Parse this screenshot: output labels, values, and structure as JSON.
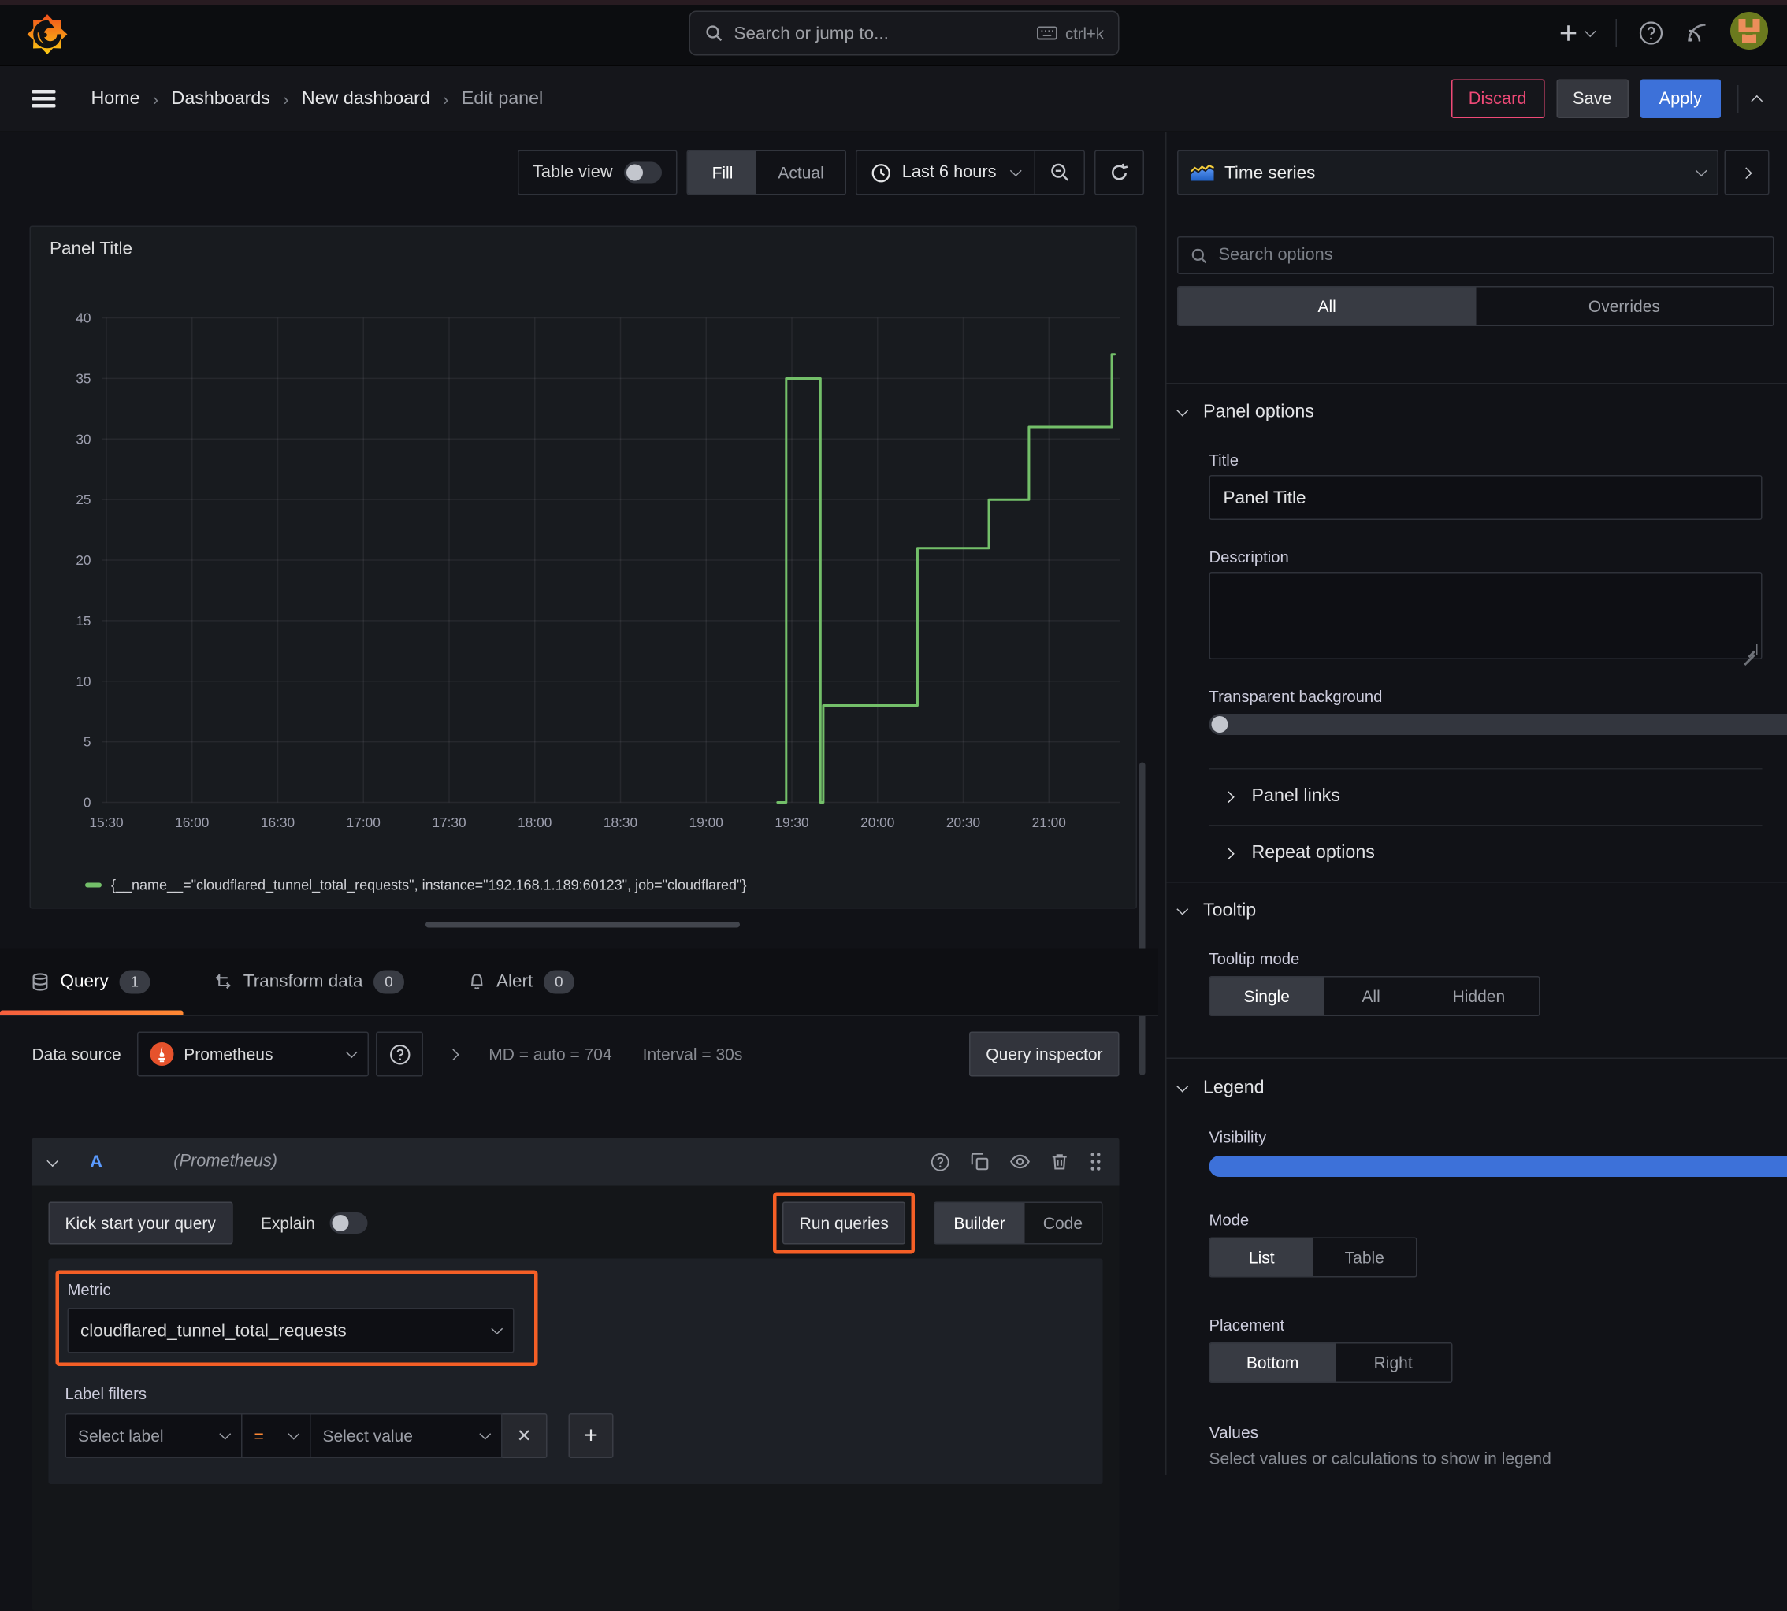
{
  "topbar": {
    "search_placeholder": "Search or jump to...",
    "shortcut": "ctrl+k"
  },
  "breadcrumb": {
    "items": [
      "Home",
      "Dashboards",
      "New dashboard",
      "Edit panel"
    ]
  },
  "header_actions": {
    "discard": "Discard",
    "save": "Save",
    "apply": "Apply"
  },
  "toolbar": {
    "table_view_label": "Table view",
    "fill_label": "Fill",
    "actual_label": "Actual",
    "time_range_label": "Last 6 hours"
  },
  "panel": {
    "title": "Panel Title",
    "legend_text": "{__name__=\"cloudflared_tunnel_total_requests\", instance=\"192.168.1.189:60123\", job=\"cloudflared\"}"
  },
  "chart_data": {
    "type": "line",
    "title": "Panel Title",
    "xlabel": "",
    "ylabel": "",
    "x_ticks": [
      "15:30",
      "16:00",
      "16:30",
      "17:00",
      "17:30",
      "18:00",
      "18:30",
      "19:00",
      "19:30",
      "20:00",
      "20:30",
      "21:00"
    ],
    "y_ticks": [
      0,
      5,
      10,
      15,
      20,
      25,
      30,
      35,
      40
    ],
    "ylim": [
      0,
      40
    ],
    "x_range": [
      "15:28",
      "21:25"
    ],
    "grid": true,
    "legend_position": "bottom",
    "series": [
      {
        "name": "{__name__=\"cloudflared_tunnel_total_requests\", instance=\"192.168.1.189:60123\", job=\"cloudflared\"}",
        "color": "#73bf69",
        "points": [
          [
            "19:25",
            0
          ],
          [
            "19:28",
            0
          ],
          [
            "19:28",
            35
          ],
          [
            "19:40",
            35
          ],
          [
            "19:40",
            0
          ],
          [
            "19:41",
            0
          ],
          [
            "19:41",
            8
          ],
          [
            "20:14",
            8
          ],
          [
            "20:14",
            21
          ],
          [
            "20:39",
            21
          ],
          [
            "20:39",
            25
          ],
          [
            "20:53",
            25
          ],
          [
            "20:53",
            31
          ],
          [
            "21:22",
            31
          ],
          [
            "21:22",
            37
          ],
          [
            "21:23",
            37
          ]
        ]
      }
    ]
  },
  "tabs": {
    "query_label": "Query",
    "query_count": "1",
    "transform_label": "Transform data",
    "transform_count": "0",
    "alert_label": "Alert",
    "alert_count": "0"
  },
  "query_editor": {
    "datasource_label": "Data source",
    "datasource_value": "Prometheus",
    "stats_md": "MD = auto = 704",
    "stats_interval": "Interval = 30s",
    "inspector_label": "Query inspector",
    "ref_id": "A",
    "ref_datasource": "(Prometheus)",
    "kickstart_label": "Kick start your query",
    "explain_label": "Explain",
    "run_label": "Run queries",
    "builder_label": "Builder",
    "code_label": "Code",
    "metric_label": "Metric",
    "metric_value": "cloudflared_tunnel_total_requests",
    "label_filters_label": "Label filters",
    "select_label_placeholder": "Select label",
    "operator_value": "=",
    "select_value_placeholder": "Select value"
  },
  "options_panel": {
    "visualization": "Time series",
    "search_placeholder": "Search options",
    "tab_all": "All",
    "tab_overrides": "Overrides",
    "panel_options_title": "Panel options",
    "title_label": "Title",
    "title_value": "Panel Title",
    "description_label": "Description",
    "transparent_label": "Transparent background",
    "panel_links_title": "Panel links",
    "repeat_title": "Repeat options",
    "tooltip_title": "Tooltip",
    "tooltip_mode_label": "Tooltip mode",
    "tooltip_single": "Single",
    "tooltip_all": "All",
    "tooltip_hidden": "Hidden",
    "legend_title": "Legend",
    "visibility_label": "Visibility",
    "mode_label": "Mode",
    "mode_list": "List",
    "mode_table": "Table",
    "placement_label": "Placement",
    "placement_bottom": "Bottom",
    "placement_right": "Right",
    "values_label": "Values",
    "values_hint": "Select values or calculations to show in legend"
  },
  "colors": {
    "accent_orange": "#f55f26",
    "series_green": "#73bf69",
    "primary_blue": "#3d71d9",
    "discard_pink": "#ef4a77",
    "tab_underline_start": "#f55f3e",
    "tab_underline_end": "#ff8833"
  }
}
